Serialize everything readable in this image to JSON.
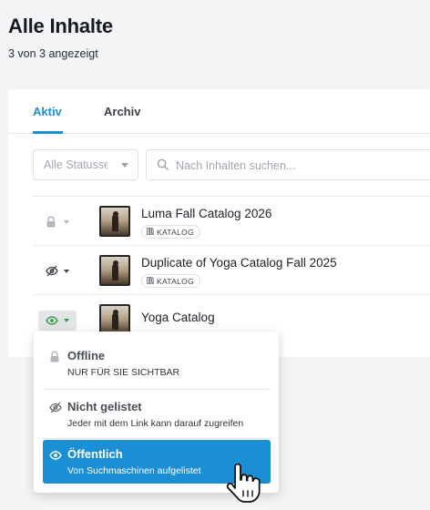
{
  "page": {
    "title": "Alle Inhalte",
    "subtitle": "3 von 3 angezeigt"
  },
  "tabs": [
    {
      "label": "Aktiv",
      "active": true
    },
    {
      "label": "Archiv",
      "active": false
    }
  ],
  "filters": {
    "status_placeholder": "Alle Statusse",
    "search_placeholder": "Nach Inhalten suchen..."
  },
  "rows": [
    {
      "visibility": "lock-icon",
      "name": "Luma Fall Catalog 2026",
      "badge": "KATALOG"
    },
    {
      "visibility": "eye-slash-icon",
      "name": "Duplicate of Yoga Catalog Fall 2025",
      "badge": "KATALOG"
    },
    {
      "visibility": "eye-icon",
      "name": "Yoga Catalog",
      "badge": ""
    }
  ],
  "visibility_menu": {
    "options": [
      {
        "icon": "lock-icon",
        "title": "Offline",
        "description": "NUR FÜR SIE SICHTBAR",
        "selected": false
      },
      {
        "icon": "eye-slash-icon",
        "title": "Nicht gelistet",
        "description": "Jeder mit dem Link kann darauf zugreifen",
        "selected": false
      },
      {
        "icon": "eye-icon",
        "title": "Öffentlich",
        "description": "Von Suchmaschinen aufgelistet",
        "selected": true
      }
    ]
  },
  "colors": {
    "accent": "#1a8fd6",
    "public_green": "#2fa24a"
  }
}
